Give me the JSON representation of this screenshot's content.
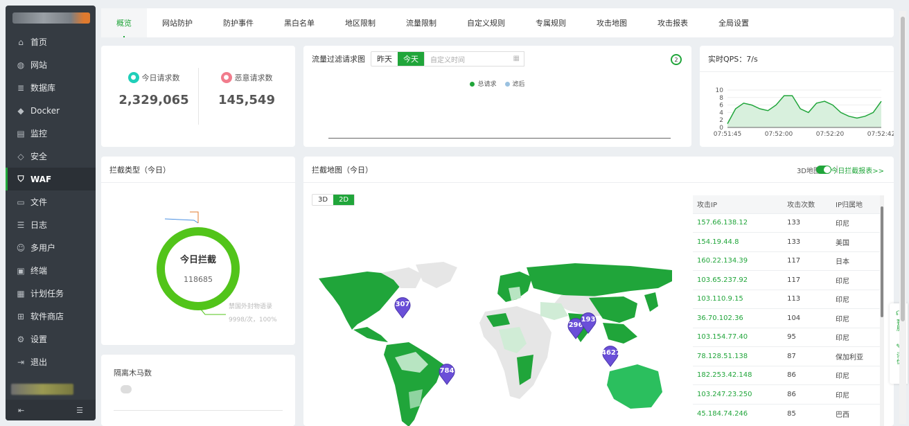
{
  "sidebar": {
    "items": [
      {
        "label": "首页",
        "icon": "home-icon"
      },
      {
        "label": "网站",
        "icon": "globe-icon"
      },
      {
        "label": "数据库",
        "icon": "database-icon"
      },
      {
        "label": "Docker",
        "icon": "docker-icon"
      },
      {
        "label": "监控",
        "icon": "monitor-icon"
      },
      {
        "label": "安全",
        "icon": "shield-icon"
      },
      {
        "label": "WAF",
        "icon": "waf-shield-icon"
      },
      {
        "label": "文件",
        "icon": "folder-icon"
      },
      {
        "label": "日志",
        "icon": "log-icon"
      },
      {
        "label": "多用户",
        "icon": "users-icon"
      },
      {
        "label": "终端",
        "icon": "terminal-icon"
      },
      {
        "label": "计划任务",
        "icon": "calendar-icon"
      },
      {
        "label": "软件商店",
        "icon": "apps-icon"
      },
      {
        "label": "设置",
        "icon": "gear-icon"
      },
      {
        "label": "退出",
        "icon": "logout-icon"
      }
    ],
    "active": "WAF"
  },
  "tabs": [
    "概览",
    "网站防护",
    "防护事件",
    "黑白名单",
    "地区限制",
    "流量限制",
    "自定义规则",
    "专属规则",
    "攻击地图",
    "攻击报表",
    "全局设置"
  ],
  "stats": {
    "today_label": "今日请求数",
    "today_value": "2,329,065",
    "malicious_label": "恶意请求数",
    "malicious_value": "145,549"
  },
  "traffic": {
    "title": "流量过滤请求图",
    "btn_yesterday": "昨天",
    "btn_today": "今天",
    "custom_placeholder": "自定义时间",
    "refresh_count": "2",
    "legend_total": "总请求",
    "legend_filtered": "滤后"
  },
  "qps": {
    "title": "实时QPS：7/s"
  },
  "intercept": {
    "title": "拦截类型（今日）",
    "center_label": "今日拦截",
    "center_value": "118685",
    "slice_label": "禁国外封物语录",
    "slice_detail": "9998/次，100%"
  },
  "trojan": {
    "title": "隔离木马数"
  },
  "map": {
    "title": "拦截地图（今日）",
    "toggle_label": "3D地图",
    "report_link": "今日拦截报表>>",
    "mode_3d": "3D",
    "mode_2d": "2D",
    "markers": [
      "307",
      "296",
      "193",
      "4627",
      "784"
    ]
  },
  "ip_table": {
    "headers": [
      "攻击IP",
      "攻击次数",
      "IP归属地"
    ],
    "rows": [
      [
        "157.66.138.12",
        "133",
        "印尼"
      ],
      [
        "154.19.44.8",
        "133",
        "美国"
      ],
      [
        "160.22.134.39",
        "117",
        "日本"
      ],
      [
        "103.65.237.92",
        "117",
        "印尼"
      ],
      [
        "103.110.9.15",
        "113",
        "印尼"
      ],
      [
        "36.70.102.36",
        "104",
        "印尼"
      ],
      [
        "103.154.77.40",
        "95",
        "印尼"
      ],
      [
        "78.128.51.138",
        "87",
        "保加利亚"
      ],
      [
        "182.253.42.148",
        "86",
        "印尼"
      ],
      [
        "103.247.23.250",
        "86",
        "印尼"
      ],
      [
        "45.184.74.246",
        "85",
        "巴西"
      ]
    ]
  },
  "float": {
    "service": "客服",
    "review": "评价"
  },
  "chart_data": [
    {
      "type": "line",
      "x": [
        "07:51:45",
        "07:51:48",
        "07:51:51",
        "07:51:54",
        "07:51:57",
        "07:52:00",
        "07:52:03",
        "07:52:06",
        "07:52:09",
        "07:52:12",
        "07:52:15",
        "07:52:18",
        "07:52:21",
        "07:52:24",
        "07:52:27",
        "07:52:30",
        "07:52:33",
        "07:52:36",
        "07:52:39",
        "07:52:42"
      ],
      "values": [
        1,
        5,
        6.5,
        6,
        5,
        4.5,
        6,
        8.5,
        8.5,
        5,
        4,
        6.5,
        7,
        6,
        4,
        3,
        2.5,
        3,
        4,
        7
      ],
      "xticks": [
        "07:51:45",
        "07:52:00",
        "07:52:20",
        "07:52:42"
      ],
      "yticks": [
        "0",
        "2",
        "4",
        "6",
        "8",
        "10"
      ],
      "ylim": [
        0,
        10
      ],
      "color": "#20a53a"
    },
    {
      "type": "pie",
      "categories": [
        "禁国外封物语录"
      ],
      "values": [
        9998
      ],
      "color": "#52c41a"
    }
  ]
}
